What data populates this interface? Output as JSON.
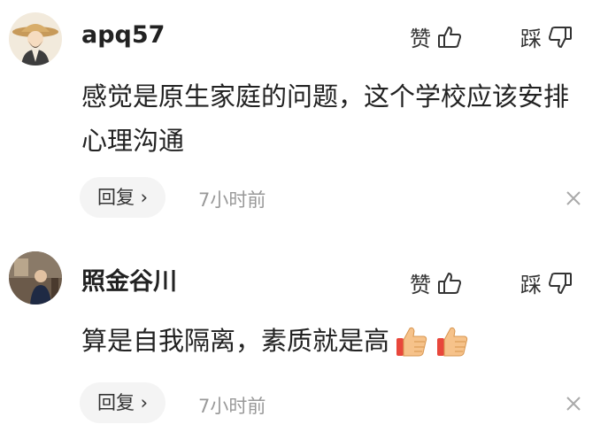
{
  "comments": [
    {
      "username": "apq57",
      "text": "感觉是原生家庭的问题，这个学校应该安排心理沟通",
      "like_label": "赞",
      "dislike_label": "踩",
      "reply_label": "回复 ›",
      "time": "7小时前"
    },
    {
      "username": "照金谷川",
      "text": "算是自我隔离，素质就是高",
      "like_label": "赞",
      "dislike_label": "踩",
      "reply_label": "回复 ›",
      "time": "7小时前"
    }
  ],
  "icons": [
    "avatar-monk-icon",
    "avatar-photo-icon",
    "thumbs-up-icon",
    "thumbs-down-icon",
    "close-icon",
    "thumbs-up-emoji-icon"
  ],
  "colors": {
    "text": "#222222",
    "muted": "#999999",
    "reply_bg": "#f4f4f4"
  }
}
